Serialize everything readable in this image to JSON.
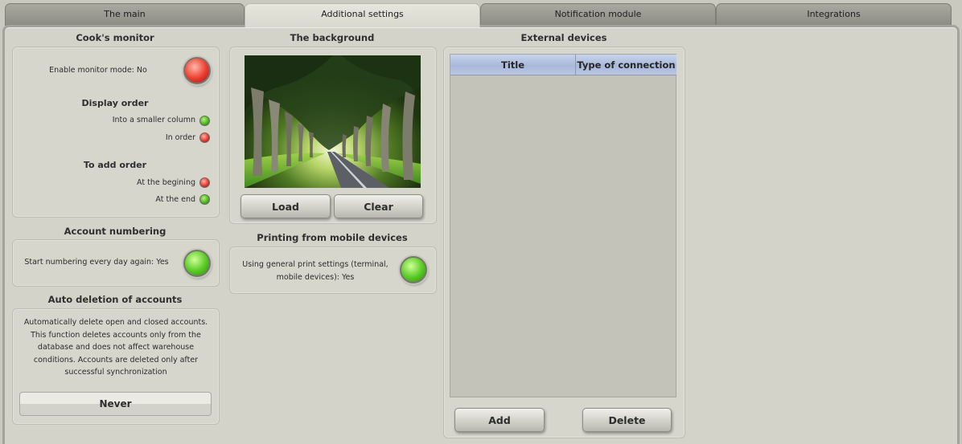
{
  "tabs": [
    {
      "label": "The main"
    },
    {
      "label": "Additional settings"
    },
    {
      "label": "Notification module"
    },
    {
      "label": "Integrations"
    }
  ],
  "cooks_monitor": {
    "heading": "Cook's monitor",
    "enable_label": "Enable monitor mode: No",
    "enable_state": "red",
    "display_order": {
      "heading": "Display order",
      "options": [
        {
          "label": "Into a smaller column",
          "state": "green"
        },
        {
          "label": "In order",
          "state": "red"
        }
      ]
    },
    "add_order": {
      "heading": "To add order",
      "options": [
        {
          "label": "At the begining",
          "state": "red"
        },
        {
          "label": "At the end",
          "state": "green"
        }
      ]
    }
  },
  "account_numbering": {
    "heading": "Account numbering",
    "label": "Start numbering every day again: Yes",
    "state": "green"
  },
  "auto_deletion": {
    "heading": "Auto deletion of accounts",
    "description_lines": [
      "Automatically delete open and closed accounts.",
      "This function deletes accounts only from the",
      "database and does not affect warehouse",
      "conditions. Accounts are deleted only after",
      "successful synchronization"
    ],
    "value": "Never"
  },
  "background": {
    "heading": "The background",
    "load_label": "Load",
    "clear_label": "Clear"
  },
  "mobile_printing": {
    "heading": "Printing from mobile devices",
    "label_lines": [
      "Using general print settings (terminal,",
      "mobile devices): Yes"
    ],
    "state": "green"
  },
  "external_devices": {
    "heading": "External devices",
    "columns": [
      "Title",
      "Type of connection"
    ],
    "rows": [],
    "add_label": "Add",
    "delete_label": "Delete"
  },
  "colors": {
    "green_state": "#45b21b",
    "red_state": "#e0342a",
    "table_header": "#a9b8da"
  }
}
